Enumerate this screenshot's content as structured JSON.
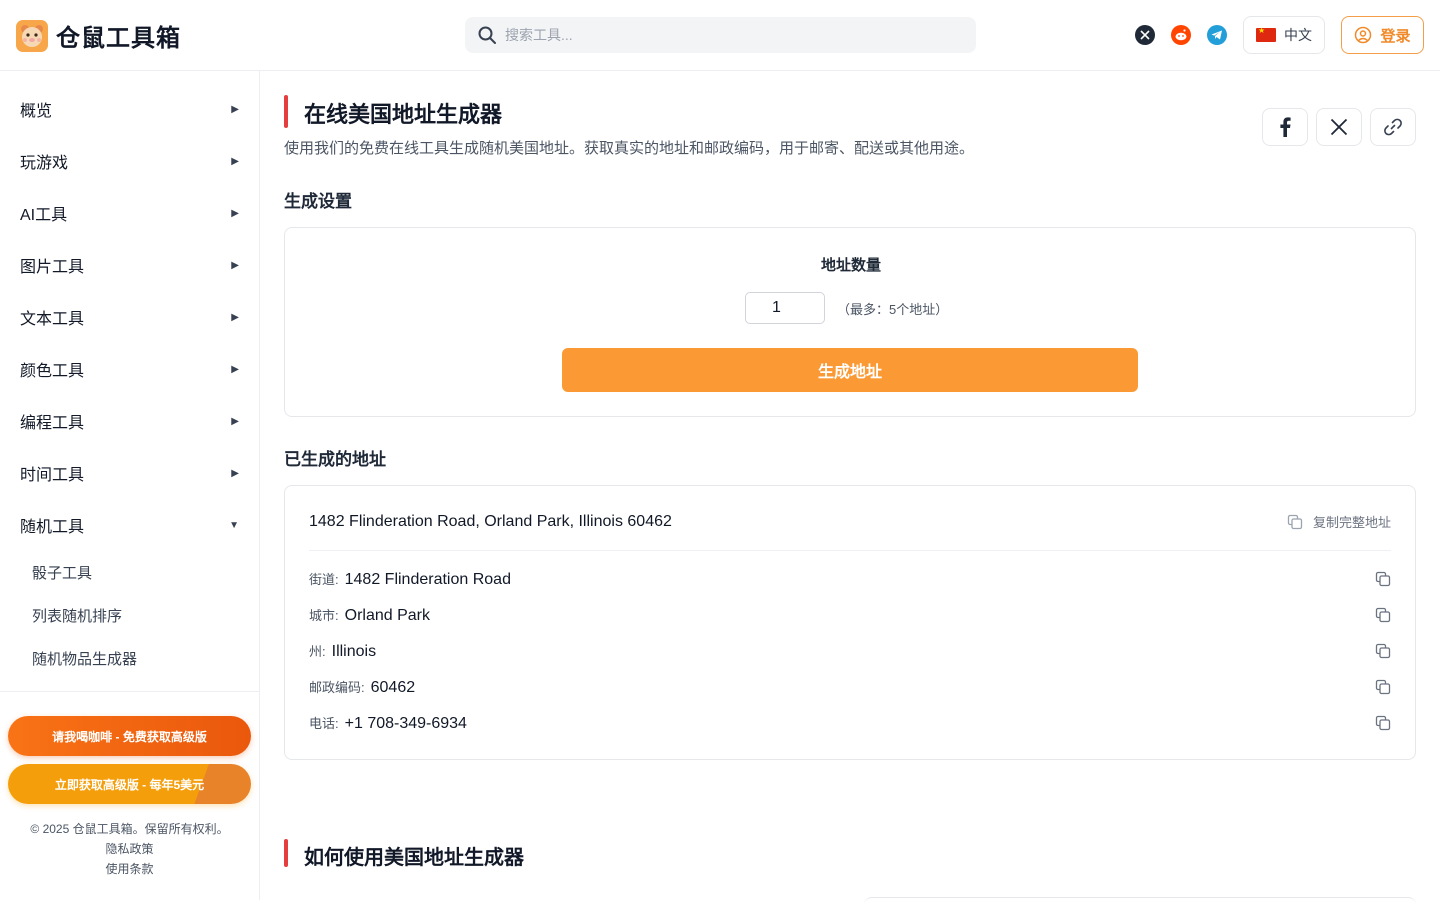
{
  "header": {
    "brand": "仓鼠工具箱",
    "search_placeholder": "搜索工具...",
    "language": "中文",
    "login": "登录"
  },
  "sidebar": {
    "items": [
      {
        "label": "概览",
        "arrow": "▶"
      },
      {
        "label": "玩游戏",
        "arrow": "▶"
      },
      {
        "label": "AI工具",
        "arrow": "▶"
      },
      {
        "label": "图片工具",
        "arrow": "▶"
      },
      {
        "label": "文本工具",
        "arrow": "▶"
      },
      {
        "label": "颜色工具",
        "arrow": "▶"
      },
      {
        "label": "编程工具",
        "arrow": "▶"
      },
      {
        "label": "时间工具",
        "arrow": "▶"
      },
      {
        "label": "随机工具",
        "arrow": "▼"
      }
    ],
    "sub_items": [
      "骰子工具",
      "列表随机排序",
      "随机物品生成器"
    ],
    "coffee_button": "请我喝咖啡 - 免费获取高级版",
    "premium_button": "立即获取高级版 - 每年5美元",
    "copyright": "© 2025 仓鼠工具箱。保留所有权利。",
    "privacy": "隐私政策",
    "terms": "使用条款"
  },
  "main": {
    "title": "在线美国地址生成器",
    "description": "使用我们的免费在线工具生成随机美国地址。获取真实的地址和邮政编码，用于邮寄、配送或其他用途。",
    "settings_title": "生成设置",
    "count_label": "地址数量",
    "count_value": "1",
    "count_hint": "（最多：5个地址）",
    "generate_button": "生成地址",
    "results_title": "已生成的地址",
    "full_address": "1482 Flinderation Road, Orland Park, Illinois 60462",
    "copy_full": "复制完整地址",
    "fields": [
      {
        "label": "街道:",
        "value": "1482 Flinderation Road"
      },
      {
        "label": "城市:",
        "value": "Orland Park"
      },
      {
        "label": "州:",
        "value": "Illinois"
      },
      {
        "label": "邮政编码:",
        "value": "60462"
      },
      {
        "label": "电话:",
        "value": "+1 708-349-6934"
      }
    ],
    "how_title": "如何使用美国地址生成器"
  },
  "colors": {
    "accent": "#fb9a35",
    "title_bar": "#e53e3e",
    "login": "#f08a2a"
  },
  "icons": [
    "hamster-logo-icon",
    "search-icon",
    "x-icon",
    "reddit-icon",
    "telegram-icon",
    "china-flag-icon",
    "user-circle-icon",
    "facebook-icon",
    "link-icon",
    "copy-icon"
  ]
}
